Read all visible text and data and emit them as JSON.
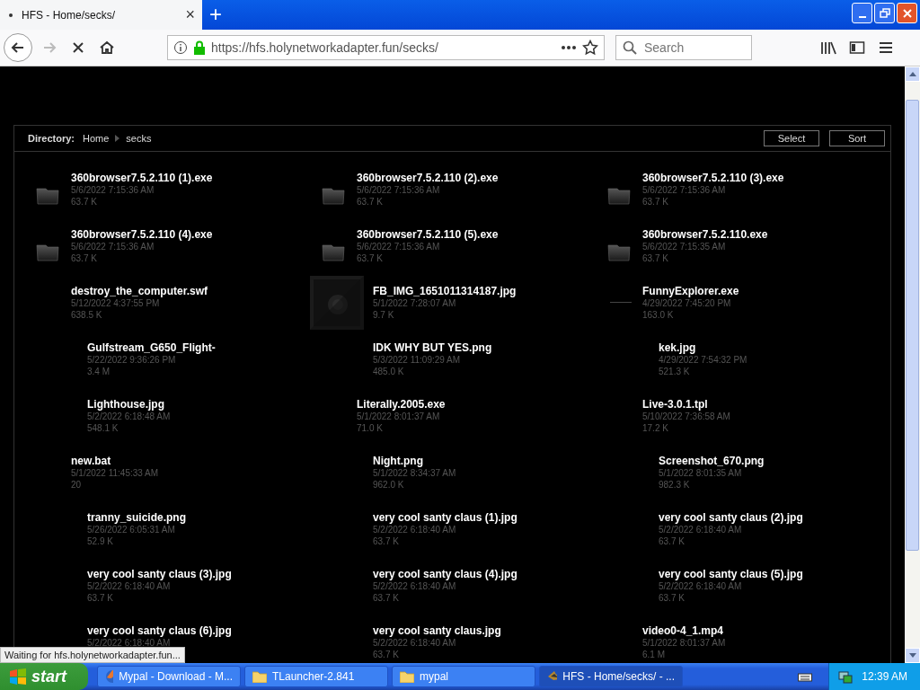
{
  "tab": {
    "title": "HFS - Home/secks/",
    "close": "×",
    "new_tab": "+"
  },
  "nav": {
    "url": "https://hfs.holynetworkadapter.fun/secks/",
    "search": {
      "placeholder": "Search"
    },
    "forward_disabled": true
  },
  "directory": {
    "label": "Directory:",
    "crumbs": [
      "Home",
      "secks"
    ],
    "buttons": [
      "Select",
      "Sort"
    ]
  },
  "files": [
    {
      "name": "360browser7.5.2.110 (1).exe",
      "date": "5/6/2022 7:15:36 AM",
      "size": "63.7 K",
      "kind": "folder"
    },
    {
      "name": "360browser7.5.2.110 (2).exe",
      "date": "5/6/2022 7:15:36 AM",
      "size": "63.7 K",
      "kind": "folder"
    },
    {
      "name": "360browser7.5.2.110 (3).exe",
      "date": "5/6/2022 7:15:36 AM",
      "size": "63.7 K",
      "kind": "folder"
    },
    {
      "name": "360browser7.5.2.110 (4).exe",
      "date": "5/6/2022 7:15:36 AM",
      "size": "63.7 K",
      "kind": "folder"
    },
    {
      "name": "360browser7.5.2.110 (5).exe",
      "date": "5/6/2022 7:15:36 AM",
      "size": "63.7 K",
      "kind": "folder"
    },
    {
      "name": "360browser7.5.2.110.exe",
      "date": "5/6/2022 7:15:35 AM",
      "size": "63.7 K",
      "kind": "folder"
    },
    {
      "name": "destroy_the_computer.swf",
      "date": "5/12/2022 4:37:55 PM",
      "size": "638.5 K",
      "kind": "plain"
    },
    {
      "name": "FB_IMG_1651011314187.jpg",
      "date": "5/1/2022 7:28:07 AM",
      "size": "9.7 K",
      "kind": "picture"
    },
    {
      "name": "FunnyExplorer.exe",
      "date": "4/29/2022 7:45:20 PM",
      "size": "163.0 K",
      "kind": "dash"
    },
    {
      "name": "Gulfstream_G650_Flight-",
      "date": "5/22/2022 9:36:26 PM",
      "size": "3.4 M",
      "kind": "indented"
    },
    {
      "name": "IDK WHY BUT YES.png",
      "date": "5/3/2022 11:09:29 AM",
      "size": "485.0 K",
      "kind": "indented"
    },
    {
      "name": "kek.jpg",
      "date": "4/29/2022 7:54:32 PM",
      "size": "521.3 K",
      "kind": "indented"
    },
    {
      "name": "Lighthouse.jpg",
      "date": "5/2/2022 6:18:48 AM",
      "size": "548.1 K",
      "kind": "indented"
    },
    {
      "name": "Literally.2005.exe",
      "date": "5/1/2022 8:01:37 AM",
      "size": "71.0 K",
      "kind": "plain"
    },
    {
      "name": "Live-3.0.1.tpl",
      "date": "5/10/2022 7:36:58 AM",
      "size": "17.2 K",
      "kind": "plain"
    },
    {
      "name": "new.bat",
      "date": "5/1/2022 11:45:33 AM",
      "size": "20",
      "kind": "plain"
    },
    {
      "name": "Night.png",
      "date": "5/1/2022 8:34:37 AM",
      "size": "962.0 K",
      "kind": "indented"
    },
    {
      "name": "Screenshot_670.png",
      "date": "5/1/2022 8:01:35 AM",
      "size": "982.3 K",
      "kind": "indented"
    },
    {
      "name": "tranny_suicide.png",
      "date": "5/26/2022 6:05:31 AM",
      "size": "52.9 K",
      "kind": "indented"
    },
    {
      "name": "very cool santy claus (1).jpg",
      "date": "5/2/2022 6:18:40 AM",
      "size": "63.7 K",
      "kind": "indented"
    },
    {
      "name": "very cool santy claus (2).jpg",
      "date": "5/2/2022 6:18:40 AM",
      "size": "63.7 K",
      "kind": "indented"
    },
    {
      "name": "very cool santy claus (3).jpg",
      "date": "5/2/2022 6:18:40 AM",
      "size": "63.7 K",
      "kind": "indented"
    },
    {
      "name": "very cool santy claus (4).jpg",
      "date": "5/2/2022 6:18:40 AM",
      "size": "63.7 K",
      "kind": "indented"
    },
    {
      "name": "very cool santy claus (5).jpg",
      "date": "5/2/2022 6:18:40 AM",
      "size": "63.7 K",
      "kind": "indented"
    },
    {
      "name": "very cool santy claus (6).jpg",
      "date": "5/2/2022 6:18:40 AM",
      "kind": "indented"
    },
    {
      "name": "very cool santy claus.jpg",
      "date": "5/2/2022 6:18:40 AM",
      "size": "63.7 K",
      "kind": "indented"
    },
    {
      "name": "video0-4_1.mp4",
      "date": "5/1/2022 8:01:37 AM",
      "size": "6.1 M",
      "kind": "plain"
    }
  ],
  "status": "Waiting for hfs.holynetworkadapter.fun...",
  "taskbar": {
    "start": "start",
    "tasks": [
      {
        "label": "Mypal - Download - M...",
        "kind": "browser",
        "selected": false
      },
      {
        "label": "TLauncher-2.841",
        "kind": "folder",
        "selected": false
      },
      {
        "label": "mypal",
        "kind": "folder",
        "selected": false
      },
      {
        "label": "HFS - Home/secks/ - ...",
        "kind": "app",
        "selected": true
      }
    ],
    "clock": "12:39 AM"
  }
}
